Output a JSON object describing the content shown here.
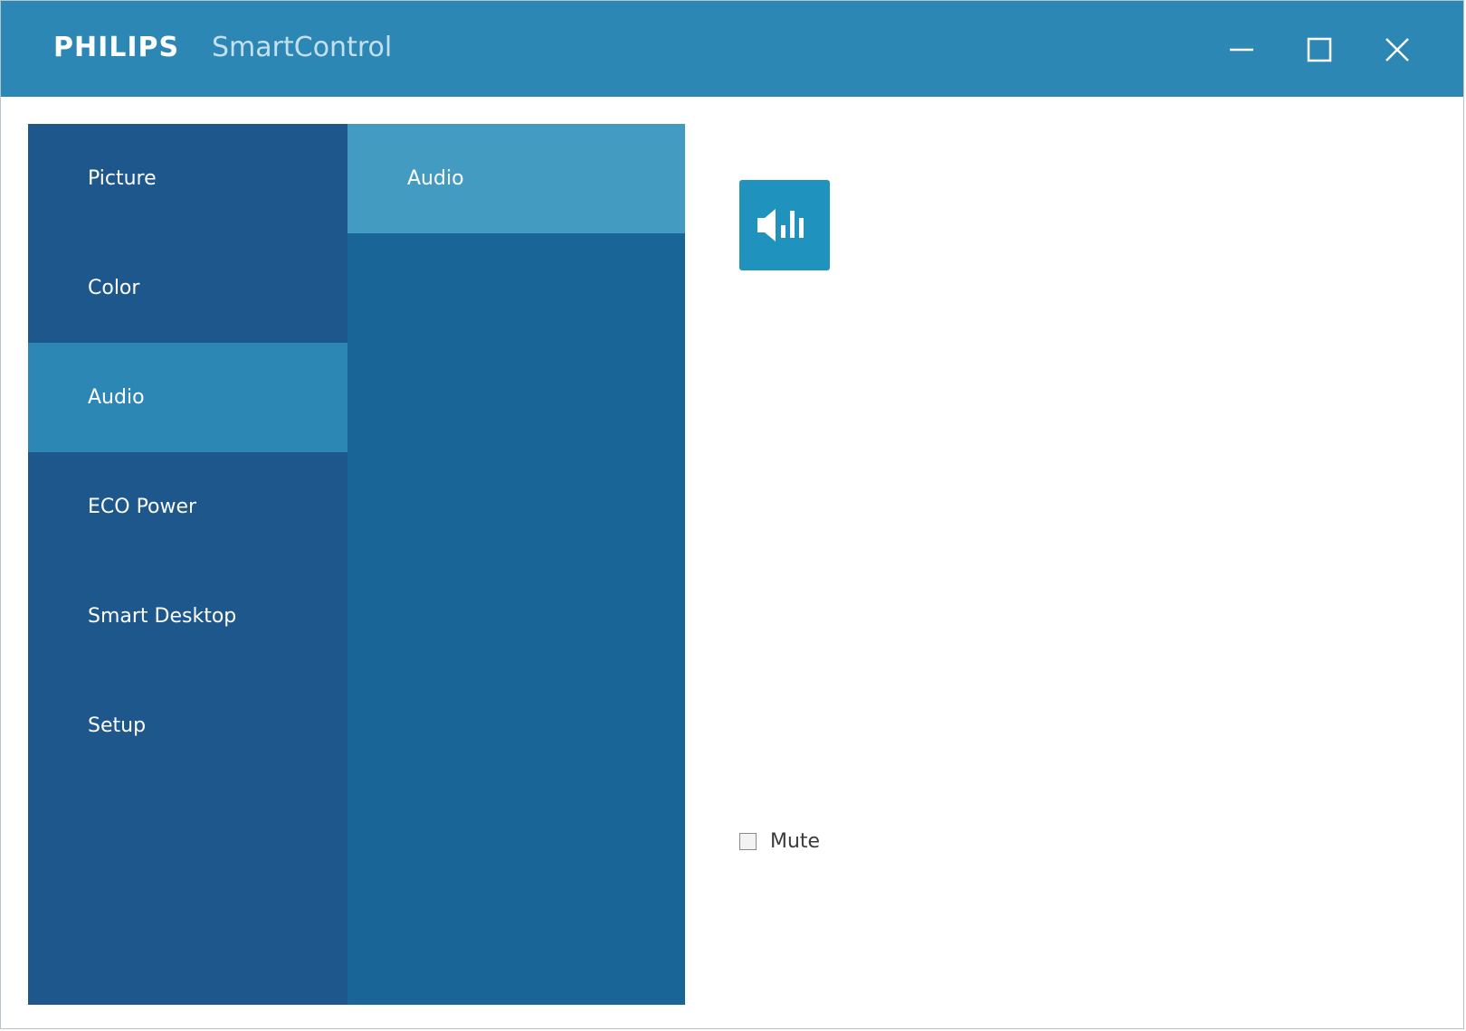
{
  "titlebar": {
    "brand": "PHILIPS",
    "app_title": "SmartControl",
    "buttons": {
      "minimize_icon": "minimize-icon",
      "maximize_icon": "maximize-icon",
      "close_icon": "close-icon"
    }
  },
  "nav": {
    "items": [
      {
        "label": "Picture",
        "active": false
      },
      {
        "label": "Color",
        "active": false
      },
      {
        "label": "Audio",
        "active": true
      },
      {
        "label": "ECO Power",
        "active": false
      },
      {
        "label": "Smart Desktop",
        "active": false
      },
      {
        "label": "Setup",
        "active": false
      }
    ]
  },
  "subnav": {
    "items": [
      {
        "label": "Audio",
        "active": true
      }
    ]
  },
  "content": {
    "tile_icon": "speaker-equalizer-icon",
    "mute": {
      "label": "Mute",
      "checked": false
    }
  },
  "colors": {
    "titlebar": "#2d87b4",
    "nav_background": "#1d578c",
    "nav_active": "#2d87b4",
    "subnav_background": "#196597",
    "subnav_active": "#449bc2",
    "tile": "#1f93bd"
  }
}
